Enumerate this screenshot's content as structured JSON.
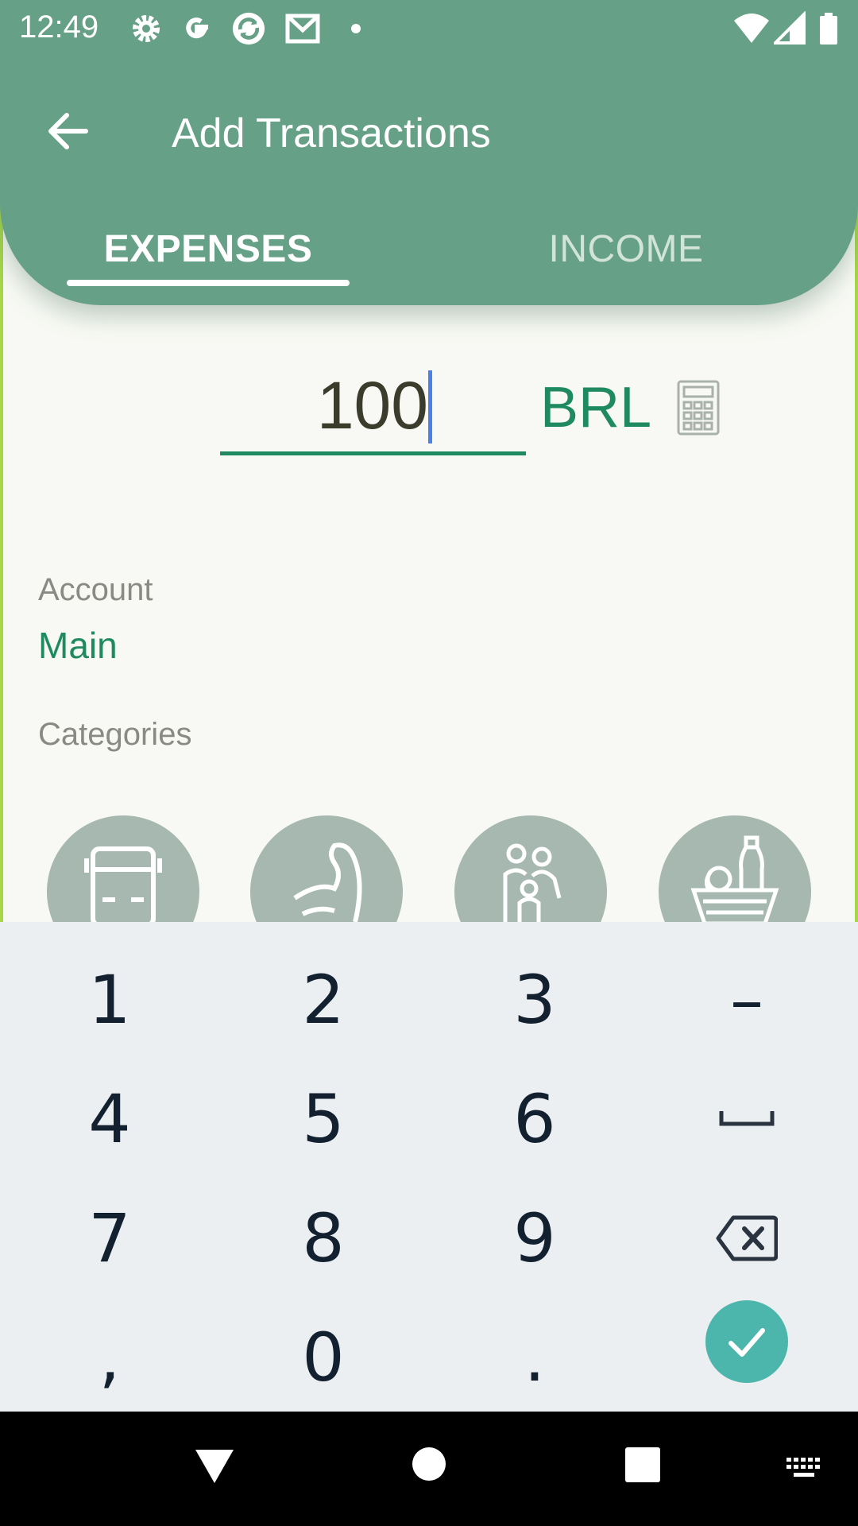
{
  "status_bar": {
    "time": "12:49",
    "icons": [
      "gear-icon",
      "google-icon",
      "sync-icon",
      "mail-icon",
      "dot-icon",
      "wifi-icon",
      "signal-icon",
      "battery-icon"
    ]
  },
  "header": {
    "title": "Add Transactions",
    "tabs": [
      {
        "label": "EXPENSES",
        "selected": true
      },
      {
        "label": "INCOME",
        "selected": false
      }
    ]
  },
  "amount": {
    "value": "100",
    "currency": "BRL"
  },
  "account": {
    "label": "Account",
    "value": "Main"
  },
  "categories": {
    "label": "Categories",
    "items": [
      "bus-icon",
      "flexed-arm-icon",
      "family-icon",
      "grocery-basket-icon"
    ]
  },
  "keypad": {
    "keys": [
      [
        "1",
        "2",
        "3",
        "–"
      ],
      [
        "4",
        "5",
        "6",
        "space"
      ],
      [
        "7",
        "8",
        "9",
        "backspace"
      ],
      [
        ",",
        "0",
        ".",
        "done"
      ]
    ]
  },
  "colors": {
    "primary": "#66a086",
    "accent": "#1f8a60",
    "background": "#f8f9f4",
    "keypad": "#eceff2",
    "ok_button": "#4db6ac",
    "category_circle": "#a6b8b0"
  }
}
